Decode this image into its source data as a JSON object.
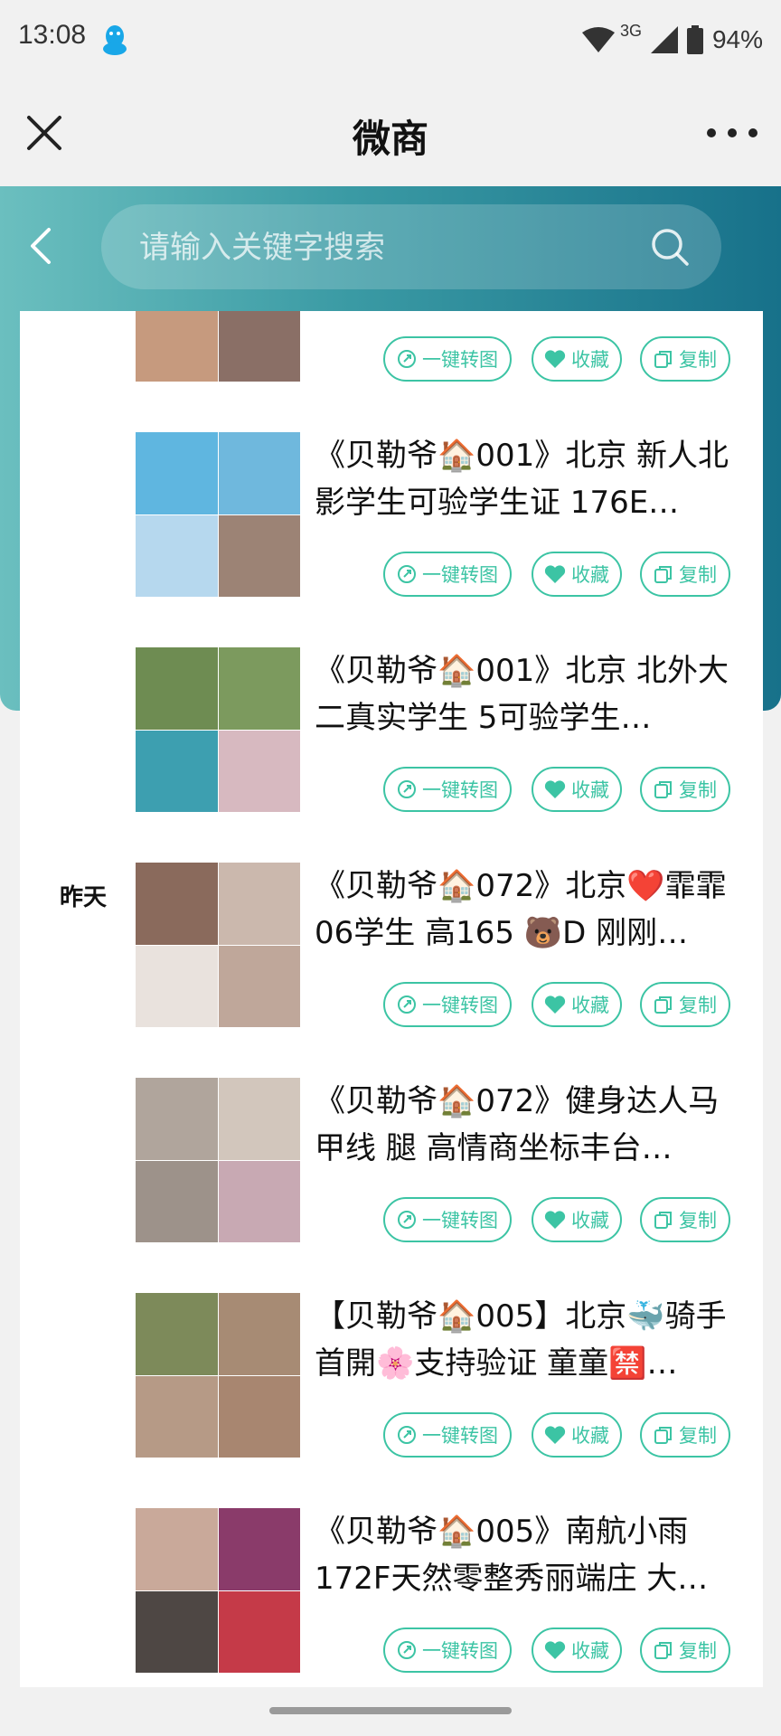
{
  "status_bar": {
    "time": "13:08",
    "network": "3G",
    "battery": "94%"
  },
  "title_bar": {
    "title": "微商",
    "close_icon": "close-icon",
    "more_icon": "more-dots-icon"
  },
  "search": {
    "placeholder": "请输入关键字搜索",
    "icon": "search-icon"
  },
  "date_label": "昨天",
  "buttons": {
    "convert": "一键转图",
    "favorite": "收藏",
    "copy": "复制"
  },
  "colors": {
    "accent": "#3cc4a4",
    "header_start": "#6bbfbf",
    "header_end": "#17718a"
  },
  "items": [
    {
      "title": ""
    },
    {
      "title": "《贝勒爷🏠001》北京 新人北影学生可验学生证 176E…"
    },
    {
      "title": "《贝勒爷🏠001》北京 北外大二真实学生 5可验学生…"
    },
    {
      "title": "《贝勒爷🏠072》北京❤️霏霏 06学生 高165 🐻D 刚刚…"
    },
    {
      "title": "《贝勒爷🏠072》健身达人马甲线 腿 高情商坐标丰台…"
    },
    {
      "title": "【贝勒爷🏠005】北京🐳骑手首開🌸支持验证 童童🈲…"
    },
    {
      "title": "《贝勒爷🏠005》南航小雨172F天然零整秀丽端庄 大…"
    }
  ]
}
